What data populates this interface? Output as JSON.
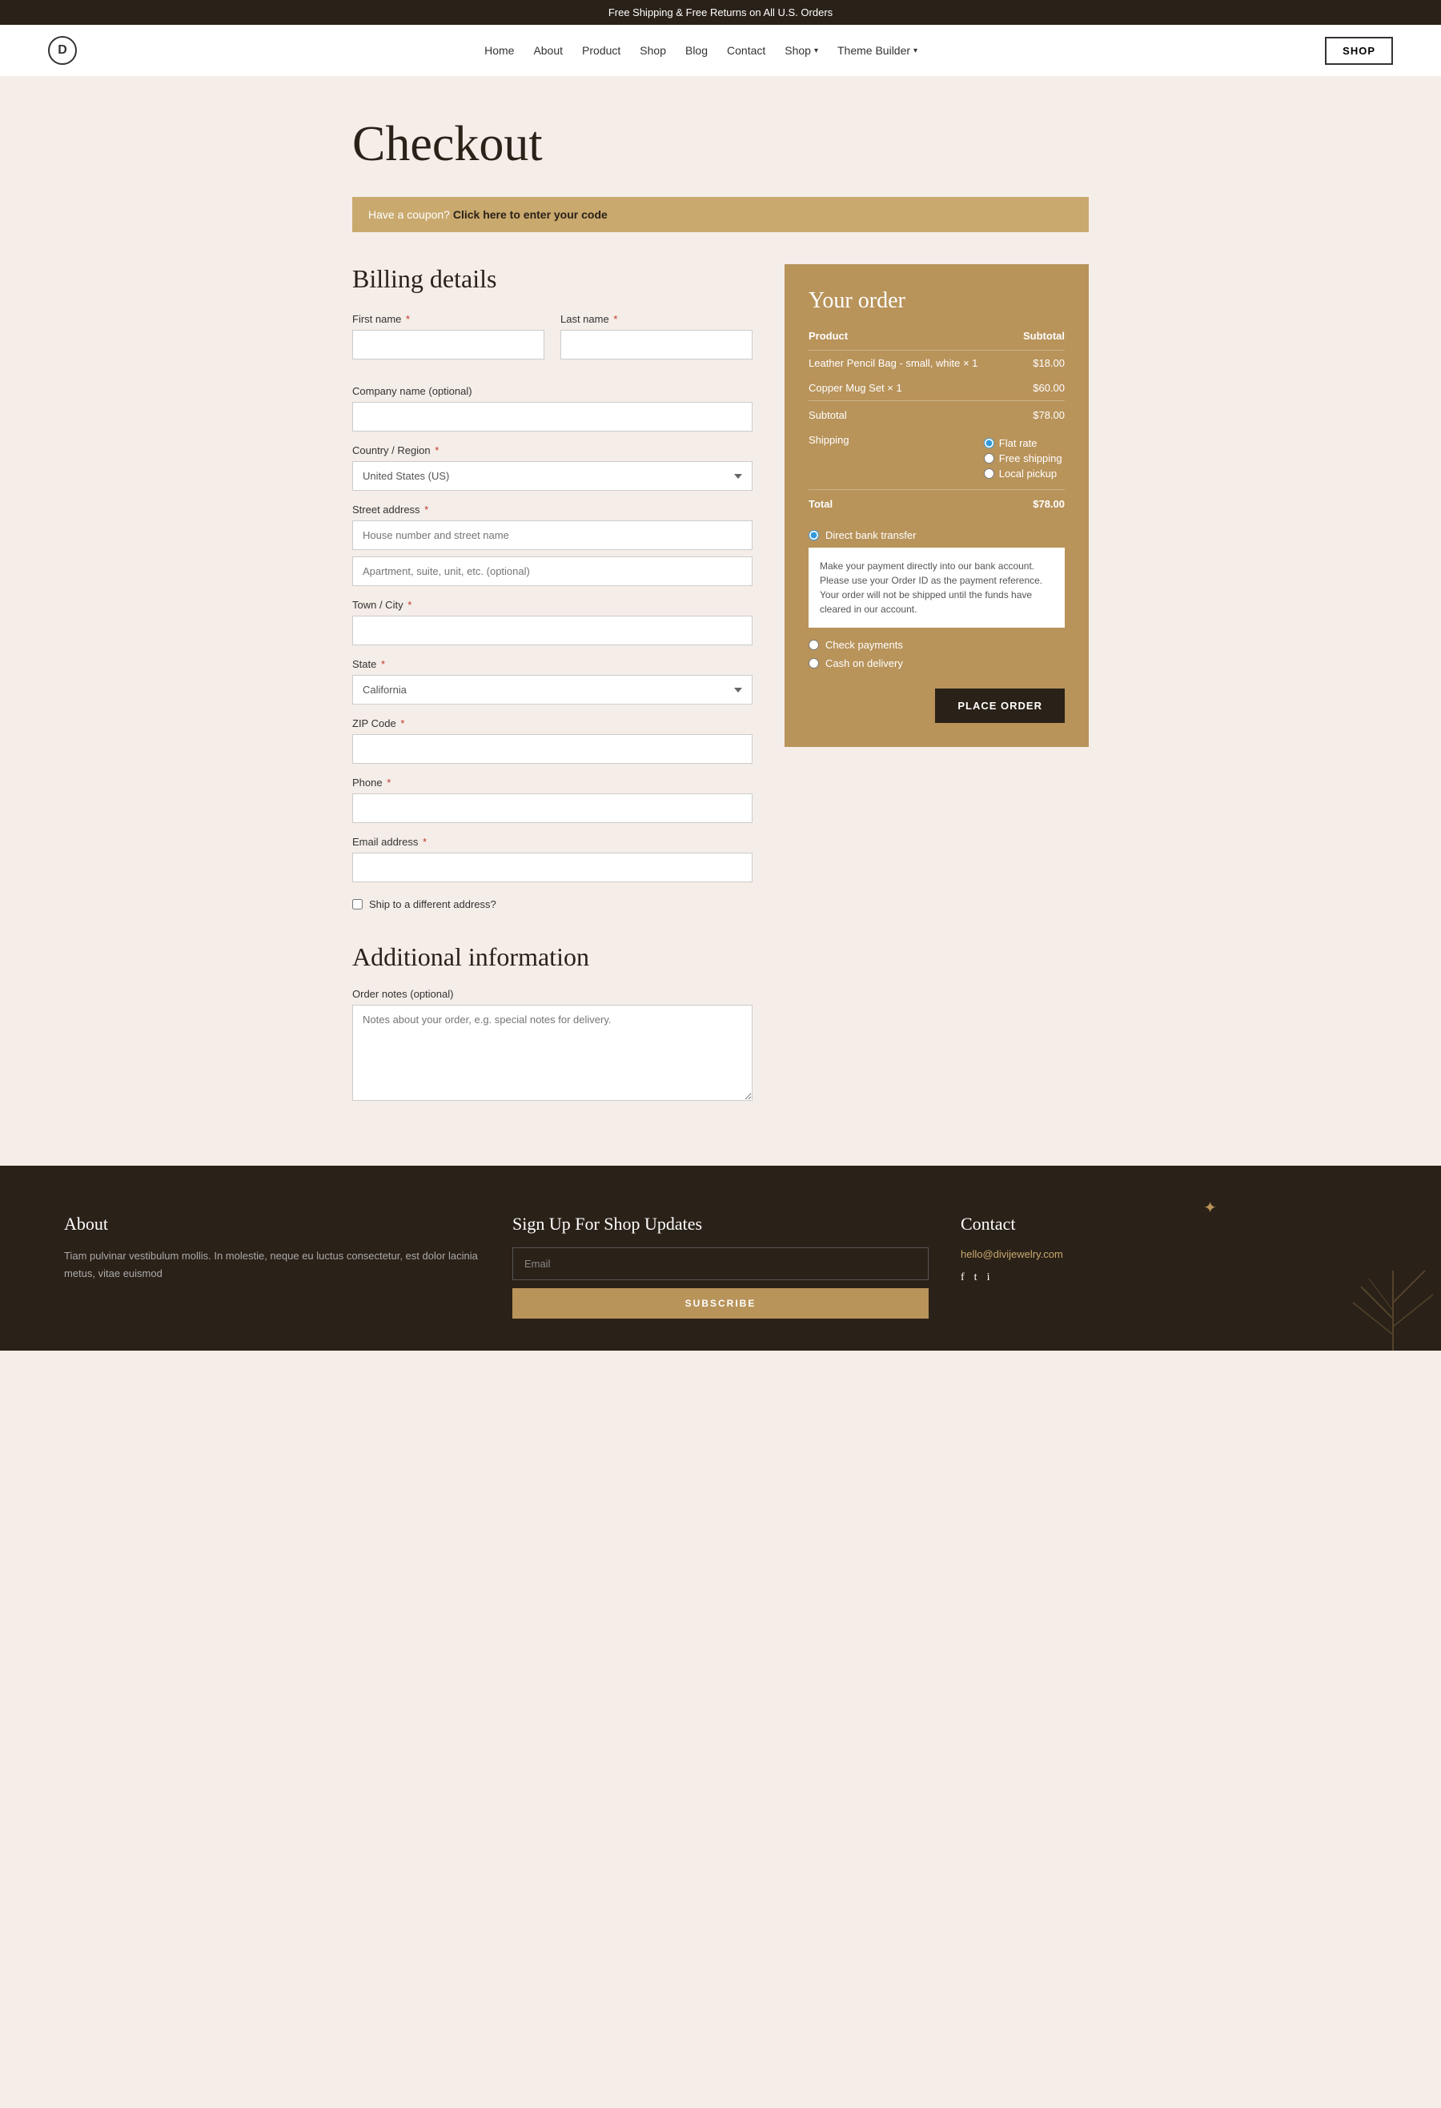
{
  "topbar": {
    "message": "Free Shipping & Free Returns on All U.S. Orders"
  },
  "nav": {
    "logo_letter": "D",
    "links": [
      {
        "label": "Home",
        "href": "#"
      },
      {
        "label": "About",
        "href": "#"
      },
      {
        "label": "Product",
        "href": "#"
      },
      {
        "label": "Shop",
        "href": "#"
      },
      {
        "label": "Blog",
        "href": "#"
      },
      {
        "label": "Contact",
        "href": "#"
      },
      {
        "label": "Shop",
        "href": "#",
        "dropdown": true
      },
      {
        "label": "Theme Builder",
        "href": "#",
        "dropdown": true
      }
    ],
    "shop_button": "SHOP"
  },
  "page": {
    "title": "Checkout",
    "coupon_text": "Have a coupon?",
    "coupon_link": "Click here to enter your code"
  },
  "billing": {
    "heading": "Billing details",
    "fields": {
      "first_name_label": "First name",
      "last_name_label": "Last name",
      "company_label": "Company name (optional)",
      "country_label": "Country / Region",
      "country_value": "United States (US)",
      "street_label": "Street address",
      "street_placeholder": "House number and street name",
      "apt_placeholder": "Apartment, suite, unit, etc. (optional)",
      "city_label": "Town / City",
      "state_label": "State",
      "state_value": "California",
      "zip_label": "ZIP Code",
      "phone_label": "Phone",
      "email_label": "Email address"
    },
    "ship_different": "Ship to a different address?"
  },
  "additional": {
    "heading": "Additional information",
    "notes_label": "Order notes (optional)",
    "notes_placeholder": "Notes about your order, e.g. special notes for delivery."
  },
  "order": {
    "heading": "Your order",
    "col_product": "Product",
    "col_subtotal": "Subtotal",
    "items": [
      {
        "name": "Leather Pencil Bag - small, white",
        "qty": "× 1",
        "price": "$18.00"
      },
      {
        "name": "Copper Mug Set",
        "qty": "× 1",
        "price": "$60.00"
      }
    ],
    "subtotal_label": "Subtotal",
    "subtotal_value": "$78.00",
    "shipping_label": "Shipping",
    "shipping_options": [
      {
        "label": "Flat rate",
        "selected": true
      },
      {
        "label": "Free shipping",
        "selected": false
      },
      {
        "label": "Local pickup",
        "selected": false
      }
    ],
    "total_label": "Total",
    "total_value": "$78.00"
  },
  "payment": {
    "options": [
      {
        "id": "direct_bank",
        "label": "Direct bank transfer",
        "selected": true,
        "info": "Make your payment directly into our bank account. Please use your Order ID as the payment reference. Your order will not be shipped until the funds have cleared in our account."
      },
      {
        "id": "check",
        "label": "Check payments",
        "selected": false
      },
      {
        "id": "cod",
        "label": "Cash on delivery",
        "selected": false
      }
    ],
    "place_order_btn": "PLACE ORDER"
  },
  "footer": {
    "about_heading": "About",
    "about_text": "Tiam pulvinar vestibulum mollis. In molestie, neque eu luctus consectetur, est dolor lacinia metus, vitae euismod",
    "signup_heading": "Sign Up For Shop Updates",
    "email_placeholder": "Email",
    "subscribe_btn": "SUBSCRIBE",
    "contact_heading": "Contact",
    "contact_email": "hello@divijewelry.com",
    "social_icons": [
      "f",
      "t",
      "i"
    ]
  }
}
